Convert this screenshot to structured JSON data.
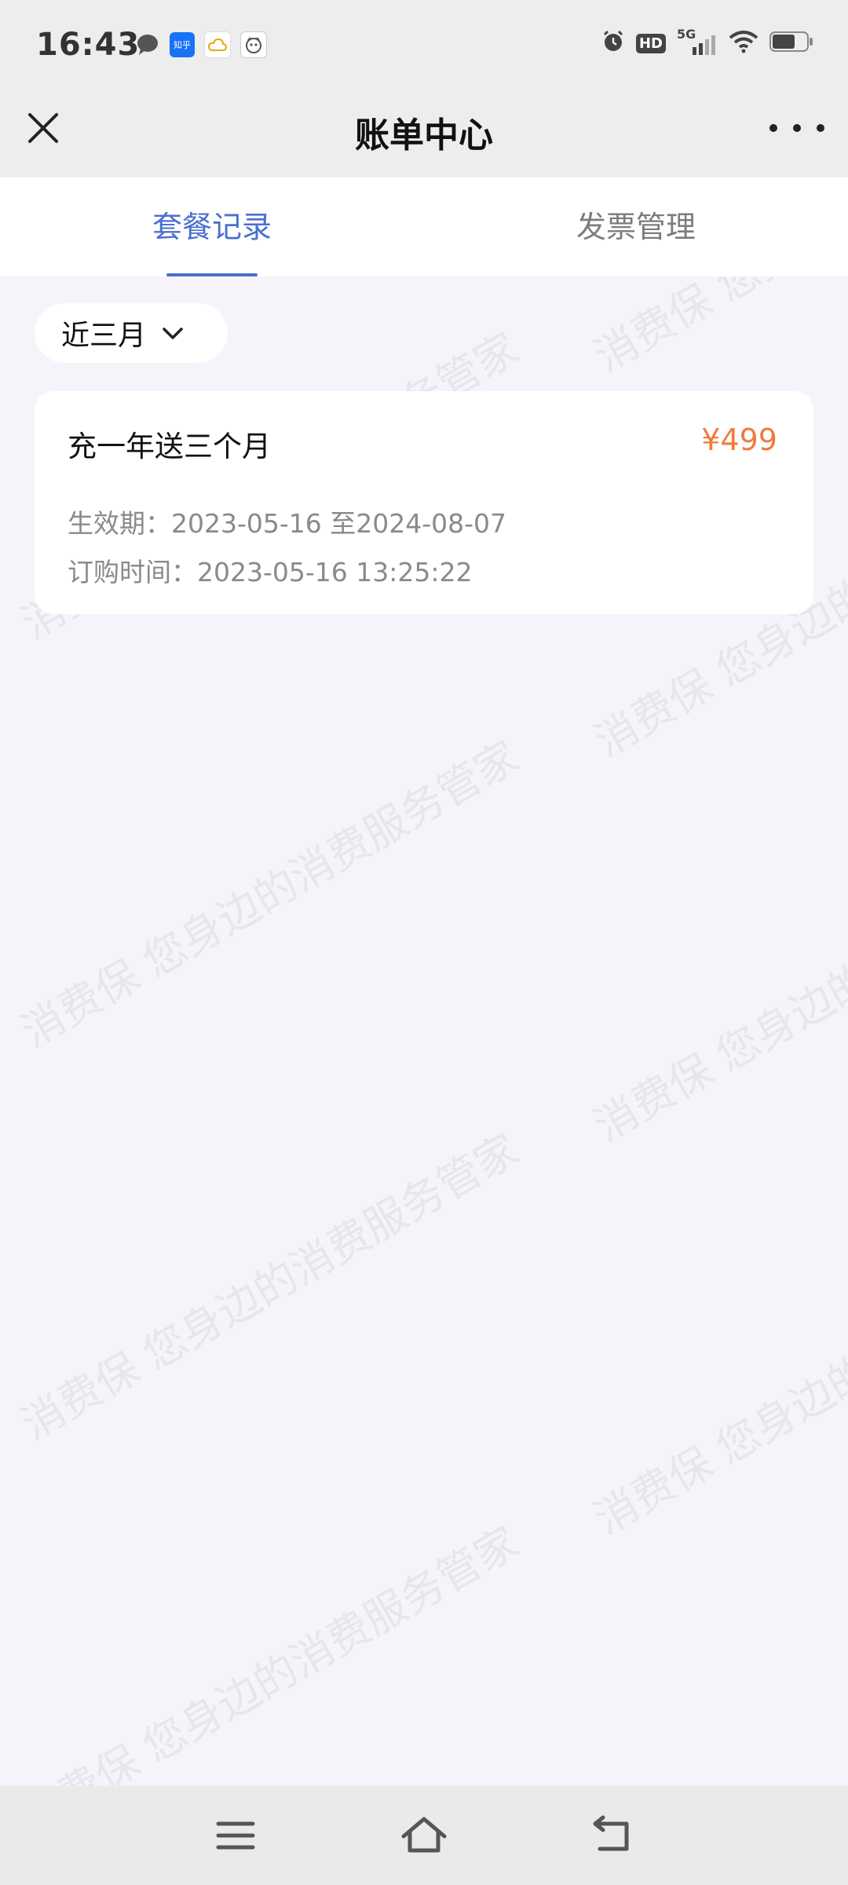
{
  "status_bar": {
    "time": "16:43",
    "notification_icons": [
      "message-icon",
      "zhihu-icon",
      "cloud-icon",
      "face-icon"
    ],
    "zhihu_label": "知乎",
    "right_icons": [
      "alarm-icon",
      "hd-icon",
      "5g-signal-icon",
      "wifi-icon",
      "battery-icon"
    ],
    "hd_label": "HD",
    "network_label": "5G"
  },
  "header": {
    "title": "账单中心",
    "close_icon": "close-icon",
    "more_icon": "more-icon"
  },
  "tabs": [
    {
      "label": "套餐记录",
      "active": true
    },
    {
      "label": "发票管理",
      "active": false
    }
  ],
  "filter": {
    "label": "近三月"
  },
  "records": [
    {
      "name": "充一年送三个月",
      "price": "¥499",
      "validity_line": "生效期：2023-05-16 至2024-08-07",
      "order_time_line": "订购时间：2023-05-16 13:25:22"
    }
  ],
  "watermark": {
    "text_a": "消费保 您身边的消费服务管家",
    "text_b": "消费保 您身边的"
  },
  "colors": {
    "accent": "#4b6fd0",
    "price": "#ef7b3d",
    "background": "#f4f4fa"
  },
  "nav_bar": {
    "icons": [
      "menu-icon",
      "home-icon",
      "back-icon"
    ]
  }
}
